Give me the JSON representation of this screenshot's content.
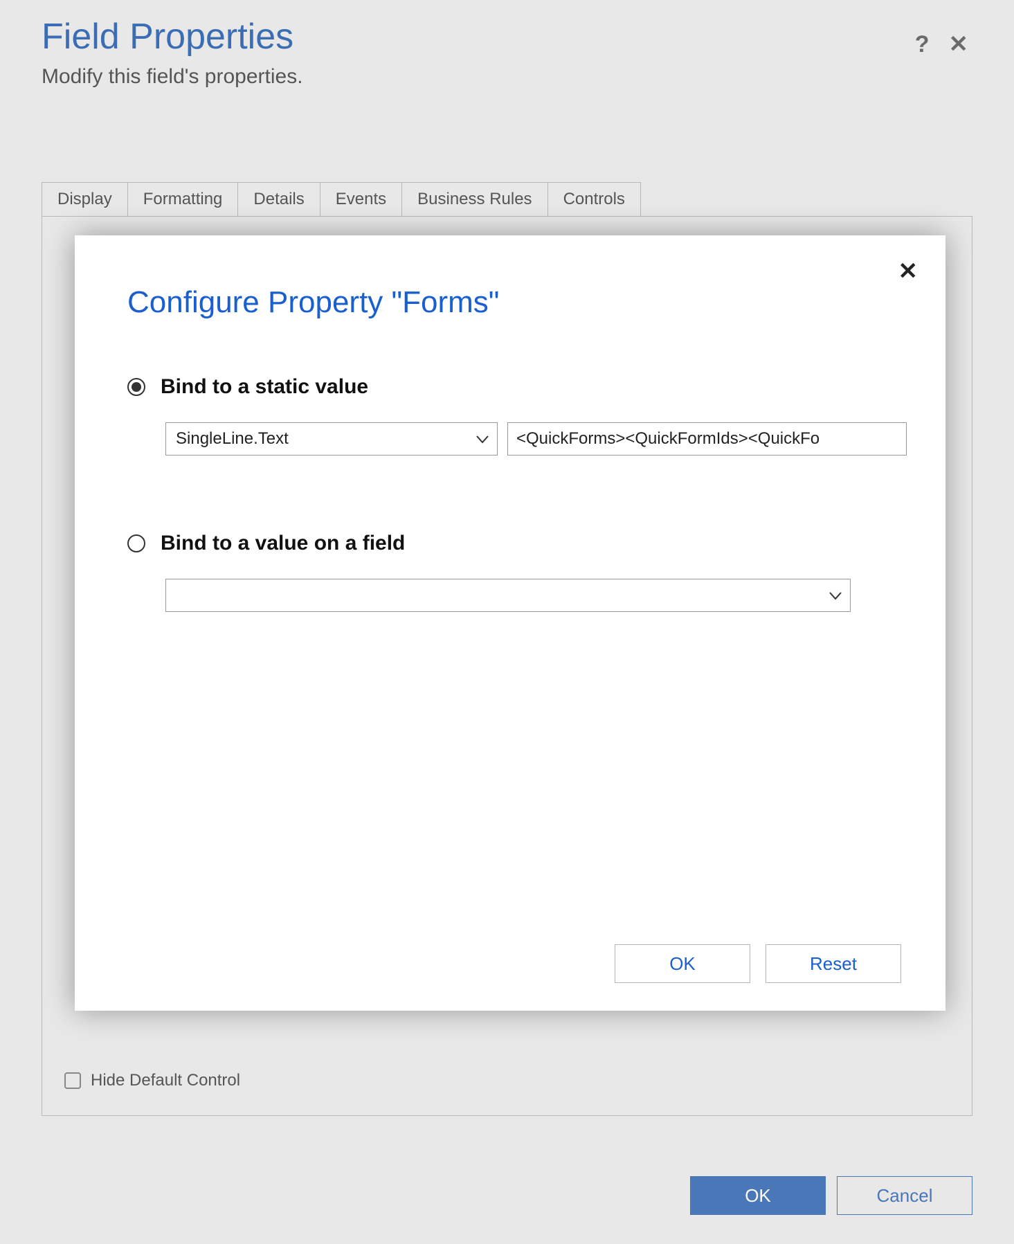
{
  "header": {
    "title": "Field Properties",
    "subtitle": "Modify this field's properties.",
    "help_icon": "?",
    "close_icon": "✕"
  },
  "tabs": [
    {
      "label": "Display"
    },
    {
      "label": "Formatting"
    },
    {
      "label": "Details"
    },
    {
      "label": "Events"
    },
    {
      "label": "Business Rules"
    },
    {
      "label": "Controls"
    }
  ],
  "controls_panel": {
    "hide_default_label": "Hide Default Control"
  },
  "footer": {
    "ok_label": "OK",
    "cancel_label": "Cancel"
  },
  "modal": {
    "title": "Configure Property \"Forms\"",
    "close_icon": "✕",
    "option_static": {
      "label": "Bind to a static value",
      "type_select_value": "SingleLine.Text",
      "value_input": "<QuickForms><QuickFormIds><QuickFo"
    },
    "option_field": {
      "label": "Bind to a value on a field",
      "field_select_value": ""
    },
    "ok_label": "OK",
    "reset_label": "Reset"
  }
}
